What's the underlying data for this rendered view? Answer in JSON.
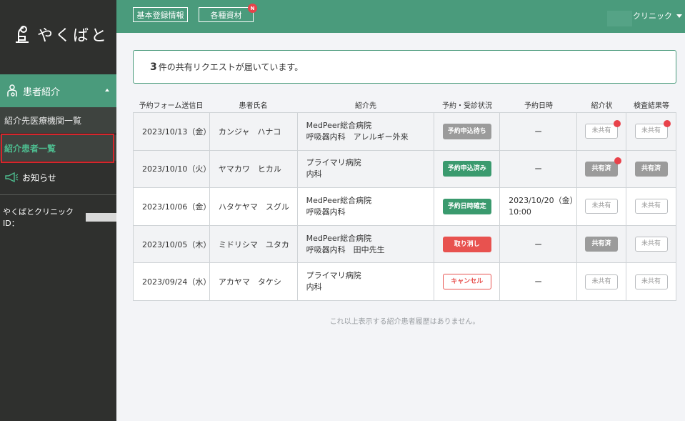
{
  "brand": {
    "logo_text": "やくばと"
  },
  "sidebar": {
    "section_label": "患者紹介",
    "items": [
      {
        "label": "紹介先医療機関一覧"
      },
      {
        "label": "紹介患者一覧"
      }
    ],
    "news_label": "お知らせ",
    "clinic_id_label": "やくばとクリニックID："
  },
  "header": {
    "buttons": [
      {
        "label": "基本登録情報"
      },
      {
        "label": "各種資材",
        "badge": "N"
      }
    ],
    "clinic_menu_label": "クリニック"
  },
  "notice": {
    "count": "3",
    "text": "件の共有リクエストが届いています。"
  },
  "table": {
    "headers": [
      "予約フォーム送信日",
      "患者氏名",
      "紹介先",
      "予約・受診状況",
      "予約日時",
      "紹介状",
      "検査結果等"
    ],
    "rows": [
      {
        "date": "2023/10/13（金）",
        "name": "カンジャ　ハナコ",
        "dest_line1": "MedPeer総合病院",
        "dest_line2": "呼吸器内科　アレルギー外来",
        "status": "予約申込待ち",
        "appt_line1": "ー",
        "appt_line2": "",
        "letter": "未共有",
        "results": "未共有"
      },
      {
        "date": "2023/10/10（火）",
        "name": "ヤマカワ　ヒカル",
        "dest_line1": "プライマリ病院",
        "dest_line2": "内科",
        "status": "予約申込済み",
        "appt_line1": "ー",
        "appt_line2": "",
        "letter": "共有済",
        "results": "共有済"
      },
      {
        "date": "2023/10/06（金）",
        "name": "ハタケヤマ　スグル",
        "dest_line1": "MedPeer総合病院",
        "dest_line2": "呼吸器内科",
        "status": "予約日時確定",
        "appt_line1": "2023/10/20（金）",
        "appt_line2": "10:00",
        "letter": "未共有",
        "results": "未共有"
      },
      {
        "date": "2023/10/05（木）",
        "name": "ミドリシマ　ユタカ",
        "dest_line1": "MedPeer総合病院",
        "dest_line2": "呼吸器内科　田中先生",
        "status": "取り消し",
        "appt_line1": "ー",
        "appt_line2": "",
        "letter": "共有済",
        "results": "未共有"
      },
      {
        "date": "2023/09/24（水）",
        "name": "アカヤマ　タケシ",
        "dest_line1": "プライマリ病院",
        "dest_line2": "内科",
        "status": "キャンセル",
        "appt_line1": "ー",
        "appt_line2": "",
        "letter": "未共有",
        "results": "未共有"
      }
    ]
  },
  "footer_note": "これ以上表示する紹介患者履歴はありません。",
  "colors": {
    "primary": "#4a9b7c",
    "sidebar": "#2f302e",
    "alert": "#e8424a",
    "cancel": "#e8524f"
  }
}
